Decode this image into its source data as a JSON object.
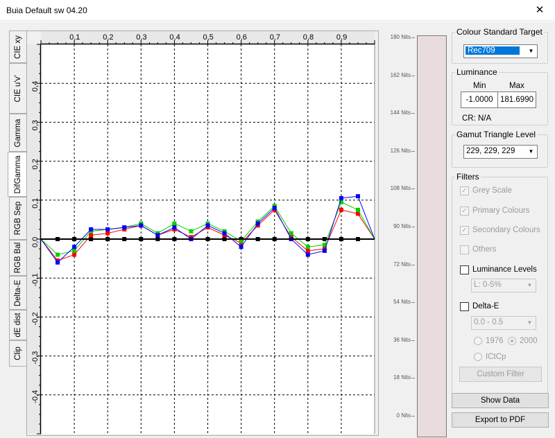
{
  "window": {
    "title": "Buia Default sw 04.20",
    "close_glyph": "✕"
  },
  "tabs": [
    {
      "label": "CIE xy",
      "active": false
    },
    {
      "label": "CIE u'v'",
      "active": false
    },
    {
      "label": "Gamma",
      "active": false
    },
    {
      "label": "DifGamma",
      "active": true
    },
    {
      "label": "RGB Sep",
      "active": false
    },
    {
      "label": "RGB Bal",
      "active": false
    },
    {
      "label": "Delta-E",
      "active": false
    },
    {
      "label": "dE dist",
      "active": false
    },
    {
      "label": "Clip",
      "active": false
    }
  ],
  "chart_data": {
    "type": "line",
    "x": [
      0,
      0.05,
      0.1,
      0.15,
      0.2,
      0.25,
      0.3,
      0.35,
      0.4,
      0.45,
      0.5,
      0.55,
      0.6,
      0.65,
      0.7,
      0.75,
      0.8,
      0.85,
      0.9,
      0.95,
      1.0
    ],
    "series": [
      {
        "color": "#000000",
        "values": [
          0,
          0,
          0,
          0,
          0,
          0,
          0,
          0,
          0,
          0,
          0,
          0,
          0,
          0,
          0,
          0,
          0,
          0,
          0,
          0,
          0
        ]
      },
      {
        "color": "#ff0000",
        "values": [
          0,
          -0.055,
          -0.04,
          0.01,
          0.015,
          0.025,
          0.035,
          0.01,
          0.025,
          0.005,
          0.03,
          0.01,
          -0.01,
          0.035,
          0.075,
          0.005,
          -0.03,
          -0.025,
          0.075,
          0.065,
          0
        ]
      },
      {
        "color": "#00d000",
        "values": [
          0,
          -0.04,
          -0.03,
          0.02,
          0.025,
          0.03,
          0.04,
          0.015,
          0.04,
          0.02,
          0.04,
          0.02,
          -0.005,
          0.045,
          0.085,
          0.015,
          -0.02,
          -0.015,
          0.095,
          0.075,
          0
        ]
      },
      {
        "color": "#0000ff",
        "values": [
          0,
          -0.06,
          -0.02,
          0.025,
          0.025,
          0.03,
          0.035,
          0.01,
          0.03,
          0.0,
          0.035,
          0.015,
          -0.02,
          0.04,
          0.08,
          0.0,
          -0.04,
          -0.03,
          0.105,
          0.11,
          0
        ]
      }
    ],
    "x_ticks": [
      "0,1",
      "0,2",
      "0,3",
      "0,4",
      "0,5",
      "0,6",
      "0,7",
      "0,8",
      "0,9"
    ],
    "x_tick_values": [
      0.1,
      0.2,
      0.3,
      0.4,
      0.5,
      0.6,
      0.7,
      0.8,
      0.9
    ],
    "y_ticks": [
      "0,4",
      "0,3",
      "0,2",
      "0,1",
      "0,0",
      "-0,1",
      "-0,2",
      "-0,3",
      "-0,4"
    ],
    "y_tick_values": [
      0.4,
      0.3,
      0.2,
      0.1,
      0.0,
      -0.1,
      -0.2,
      -0.3,
      -0.4
    ],
    "xlim": [
      0,
      1.0
    ],
    "ylim": [
      -0.5,
      0.5
    ],
    "grid": true
  },
  "luminance_scale": {
    "labels": [
      "180 Nits",
      "162 Nits",
      "144 Nits",
      "126 Nits",
      "108 Nits",
      "90 Nits",
      "72 Nits",
      "54 Nits",
      "36 Nits",
      "18 Nits",
      "0 Nits"
    ],
    "bar_color": "#e8dcdc"
  },
  "colour_standard": {
    "legend": "Colour Standard Target",
    "value": "Rec709"
  },
  "luminance": {
    "legend": "Luminance",
    "min_label": "Min",
    "max_label": "Max",
    "min_value": "-1.0000",
    "max_value": "181.6990",
    "cr": "CR: N/A"
  },
  "gamut": {
    "legend": "Gamut Triangle Level",
    "value": "229, 229, 229"
  },
  "filters": {
    "legend": "Filters",
    "grey_scale": "Grey Scale",
    "primary": "Primary Colours",
    "secondary": "Secondary Colours",
    "others": "Others",
    "luminance_levels": "Luminance Levels",
    "luminance_levels_value": "L:   0-5%",
    "delta_e": "Delta-E",
    "delta_e_value": "0.0 - 0.5",
    "r1976": "1976",
    "r2000": "2000",
    "ictcp": "ICtCp",
    "custom_filter": "Custom Filter",
    "check_glyph": "✓"
  },
  "buttons": {
    "show_data": "Show Data",
    "export_pdf": "Export to PDF"
  },
  "glyphs": {
    "dropdown": "▼"
  }
}
